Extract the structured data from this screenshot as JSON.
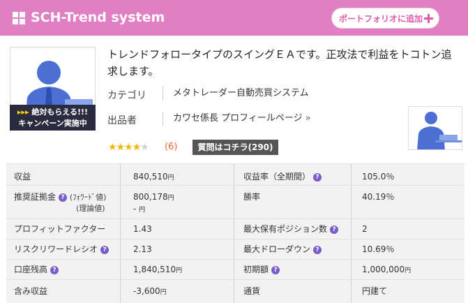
{
  "header": {
    "title": "SCH-Trend system",
    "portfolio_button": "ポートフォリオに追加"
  },
  "product": {
    "description": "トレンドフォロータイプのスイングＥＡです。正攻法で利益をトコトン追求します。",
    "campaign_line1": "絶対もらえる!!!",
    "campaign_line2": "キャンペーン実施中",
    "category_label": "カテゴリ",
    "category_value": "メタトレーダー自動売買システム",
    "seller_label": "出品者",
    "seller_value": "カワセ係長 プロフィールページ",
    "seller_more": "»",
    "rating": 4.5,
    "review_count": "(6)",
    "qa_button": "質問はコチラ(290)"
  },
  "colors": {
    "header_bg": "#e07fc2",
    "accent_pink": "#e05aa8",
    "help_icon": "#7a5cc8",
    "review_count": "#e86a30"
  },
  "stats": {
    "rows": [
      {
        "l_label": "収益",
        "l_value": "840,510",
        "l_unit": "円",
        "r_label": "収益率（全期間）",
        "r_value": "105.0％"
      },
      {
        "l_label": "推奨証拠金",
        "l_sub1": "(ﾌｫﾜｰﾄﾞ値)",
        "l_sub2": "(理論値)",
        "l_value": "800,178",
        "l_unit": "円",
        "l_value2": "-",
        "l_unit2": "円",
        "r_label": "勝率",
        "r_value": "40.19％"
      },
      {
        "l_label": "プロフィットファクター",
        "l_value": "1.43",
        "r_label": "最大保有ポジション数",
        "r_value": "2"
      },
      {
        "l_label": "リスクリワードレシオ",
        "l_value": "2.13",
        "r_label": "最大ドローダウン",
        "r_value": "10.69％"
      },
      {
        "l_label": "口座残高",
        "l_value": "1,840,510",
        "l_unit": "円",
        "r_label": "初期額",
        "r_value": "1,000,000",
        "r_unit": "円"
      },
      {
        "l_label": "含み収益",
        "l_value": "-3,600",
        "l_unit": "円",
        "r_label": "通貨",
        "r_value": "円建て"
      }
    ]
  },
  "icons": {
    "help": "?",
    "grid": "grid-icon",
    "plus": "plus-icon"
  }
}
